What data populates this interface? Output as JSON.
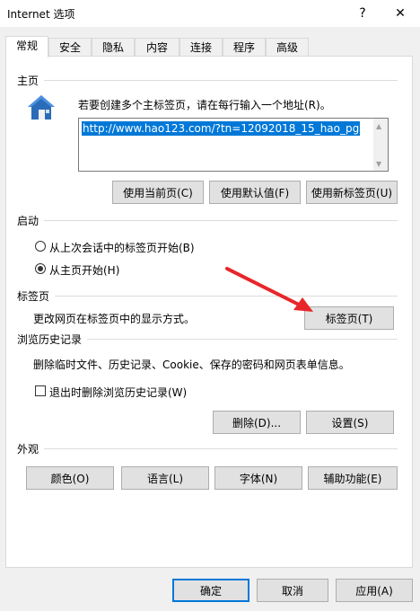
{
  "window": {
    "title": "Internet 选项",
    "help_glyph": "?",
    "close_glyph": "✕"
  },
  "tabs": [
    {
      "label": "常规"
    },
    {
      "label": "安全"
    },
    {
      "label": "隐私"
    },
    {
      "label": "内容"
    },
    {
      "label": "连接"
    },
    {
      "label": "程序"
    },
    {
      "label": "高级"
    }
  ],
  "home": {
    "section": "主页",
    "instruction": "若要创建多个主标签页，请在每行输入一个地址(R)。",
    "url": "http://www.hao123.com/?tn=12092018_15_hao_pg",
    "use_current": "使用当前页(C)",
    "use_default": "使用默认值(F)",
    "use_new_tab": "使用新标签页(U)"
  },
  "startup": {
    "section": "启动",
    "option_last_session": "从上次会话中的标签页开始(B)",
    "option_home": "从主页开始(H)",
    "selected": "option_home"
  },
  "tabs_section": {
    "section": "标签页",
    "description": "更改网页在标签页中的显示方式。",
    "button": "标签页(T)"
  },
  "history": {
    "section": "浏览历史记录",
    "description": "删除临时文件、历史记录、Cookie、保存的密码和网页表单信息。",
    "checkbox": "退出时删除浏览历史记录(W)",
    "checked": false,
    "delete": "删除(D)...",
    "settings": "设置(S)"
  },
  "appearance": {
    "section": "外观",
    "colors": "颜色(O)",
    "languages": "语言(L)",
    "fonts": "字体(N)",
    "accessibility": "辅助功能(E)"
  },
  "footer": {
    "ok": "确定",
    "cancel": "取消",
    "apply": "应用(A)"
  }
}
